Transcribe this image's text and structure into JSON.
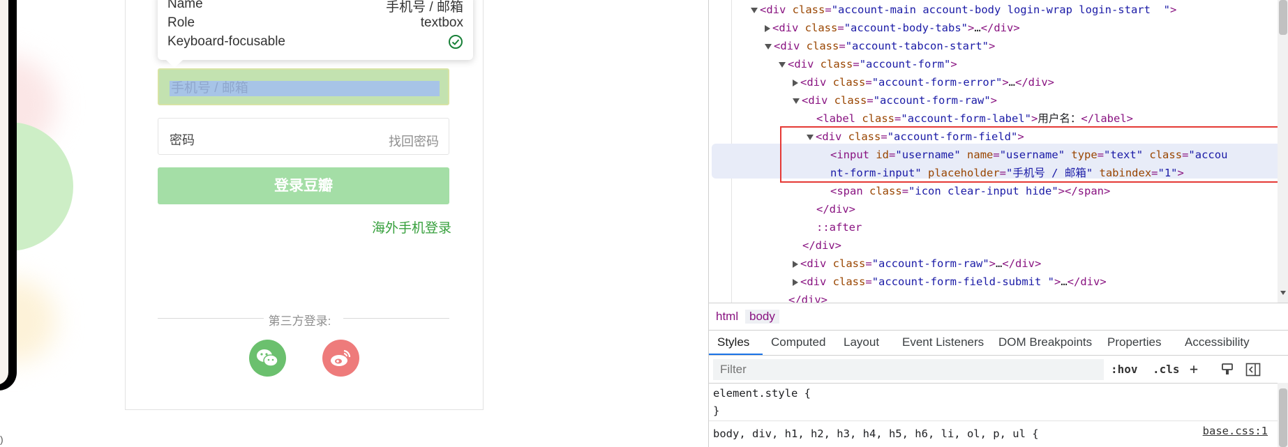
{
  "tooltip": {
    "rows": [
      {
        "key": "Name",
        "value": "手机号 / 邮箱"
      },
      {
        "key": "Role",
        "value": "textbox"
      },
      {
        "key": "Keyboard-focusable",
        "value": ""
      }
    ],
    "focusable_icon": "check-circle-icon"
  },
  "login": {
    "username_placeholder": "手机号 / 邮箱",
    "password_placeholder": "密码",
    "forgot_password": "找回密码",
    "submit": "登录豆瓣",
    "overseas_link": "海外手机登录",
    "third_party_label": "第三方登录:",
    "social": [
      {
        "name": "wechat-icon"
      },
      {
        "name": "weibo-icon"
      }
    ]
  },
  "colors": {
    "brand_green": "#37a03d",
    "button_green": "#a4dea6",
    "wechat": "#6bc06e",
    "weibo": "#ee7b7b",
    "highlight_red": "#e53935"
  },
  "devtools": {
    "lines": [
      {
        "indent": 5,
        "toggle": "open",
        "html": "<span class='tok-tag'>&lt;div</span> <span class='tok-attr'>class</span><span class='tok-tag'>=</span><span class='tok-val'>\"account-main account-body login-wrap login-start  \"</span><span class='tok-tag'>&gt;</span>"
      },
      {
        "indent": 6,
        "toggle": "closed",
        "html": "<span class='tok-tag'>&lt;div</span> <span class='tok-attr'>class</span><span class='tok-tag'>=</span><span class='tok-val'>\"account-body-tabs\"</span><span class='tok-tag'>&gt;</span><span class='tok-txt'>…</span><span class='tok-tag'>&lt;/div&gt;</span>"
      },
      {
        "indent": 6,
        "toggle": "open",
        "html": "<span class='tok-tag'>&lt;div</span> <span class='tok-attr'>class</span><span class='tok-tag'>=</span><span class='tok-val'>\"account-tabcon-start\"</span><span class='tok-tag'>&gt;</span>"
      },
      {
        "indent": 7,
        "toggle": "open",
        "html": "<span class='tok-tag'>&lt;div</span> <span class='tok-attr'>class</span><span class='tok-tag'>=</span><span class='tok-val'>\"account-form\"</span><span class='tok-tag'>&gt;</span>"
      },
      {
        "indent": 8,
        "toggle": "closed",
        "html": "<span class='tok-tag'>&lt;div</span> <span class='tok-attr'>class</span><span class='tok-tag'>=</span><span class='tok-val'>\"account-form-error\"</span><span class='tok-tag'>&gt;</span><span class='tok-txt'>…</span><span class='tok-tag'>&lt;/div&gt;</span>"
      },
      {
        "indent": 8,
        "toggle": "open",
        "html": "<span class='tok-tag'>&lt;div</span> <span class='tok-attr'>class</span><span class='tok-tag'>=</span><span class='tok-val'>\"account-form-raw\"</span><span class='tok-tag'>&gt;</span>"
      },
      {
        "indent": 9,
        "toggle": "none",
        "html": "<span class='tok-tag'>&lt;label</span> <span class='tok-attr'>class</span><span class='tok-tag'>=</span><span class='tok-val'>\"account-form-label\"</span><span class='tok-tag'>&gt;</span><span class='tok-txt'>用户名：</span><span class='tok-tag'>&lt;/label&gt;</span>"
      },
      {
        "indent": 9,
        "toggle": "open",
        "html": "<span class='tok-tag'>&lt;div</span> <span class='tok-attr'>class</span><span class='tok-tag'>=</span><span class='tok-val'>\"account-form-field\"</span><span class='tok-tag'>&gt;</span>"
      },
      {
        "indent": 10,
        "toggle": "none",
        "html": "<span class='tok-tag'>&lt;input</span> <span class='tok-attr'>id</span><span class='tok-tag'>=</span><span class='tok-val'>\"username\"</span> <span class='tok-attr'>name</span><span class='tok-tag'>=</span><span class='tok-val'>\"username\"</span> <span class='tok-attr'>type</span><span class='tok-tag'>=</span><span class='tok-val'>\"text\"</span> <span class='tok-attr'>class</span><span class='tok-tag'>=</span><span class='tok-val'>\"accou</span>"
      },
      {
        "indent": 10,
        "toggle": "none",
        "html": "<span class='tok-val'>nt-form-input\"</span> <span class='tok-attr'>placeholder</span><span class='tok-tag'>=</span><span class='tok-val'>\"手机号 / 邮箱\"</span> <span class='tok-attr'>tabindex</span><span class='tok-tag'>=</span><span class='tok-val'>\"1\"</span><span class='tok-tag'>&gt;</span>"
      },
      {
        "indent": 10,
        "toggle": "none",
        "html": "<span class='tok-tag'>&lt;span</span> <span class='tok-attr'>class</span><span class='tok-tag'>=</span><span class='tok-val'>\"icon clear-input hide\"</span><span class='tok-tag'>&gt;&lt;/span&gt;</span>"
      },
      {
        "indent": 9,
        "toggle": "none",
        "html": "<span class='tok-tag'>&lt;/div&gt;</span>"
      },
      {
        "indent": 9,
        "toggle": "none",
        "html": "<span class='tok-txt' style='color:#881280'>::after</span>"
      },
      {
        "indent": 8,
        "toggle": "none",
        "html": "<span class='tok-tag'>&lt;/div&gt;</span>"
      },
      {
        "indent": 8,
        "toggle": "closed",
        "html": "<span class='tok-tag'>&lt;div</span> <span class='tok-attr'>class</span><span class='tok-tag'>=</span><span class='tok-val'>\"account-form-raw\"</span><span class='tok-tag'>&gt;</span><span class='tok-txt'>…</span><span class='tok-tag'>&lt;/div&gt;</span>"
      },
      {
        "indent": 8,
        "toggle": "closed",
        "html": "<span class='tok-tag'>&lt;div</span> <span class='tok-attr'>class</span><span class='tok-tag'>=</span><span class='tok-val'>\"account-form-field-submit \"</span><span class='tok-tag'>&gt;</span><span class='tok-txt'>…</span><span class='tok-tag'>&lt;/div&gt;</span>"
      },
      {
        "indent": 7,
        "toggle": "none",
        "html": "<span class='tok-tag'>&lt;/div&gt;</span>"
      }
    ],
    "breadcrumbs": [
      "html",
      "body"
    ],
    "tabs": [
      "Styles",
      "Computed",
      "Layout",
      "Event Listeners",
      "DOM Breakpoints",
      "Properties",
      "Accessibility"
    ],
    "filter_placeholder": "Filter",
    "toolbar": [
      ":hov",
      ".cls",
      "+"
    ],
    "styles": {
      "element_style_open": "element.style {",
      "element_style_close": "}",
      "rule_selector": "body, div, h1, h2, h3, h4, h5, h6, li, ol, p, ul {",
      "rule_source": "base.css:1"
    }
  }
}
